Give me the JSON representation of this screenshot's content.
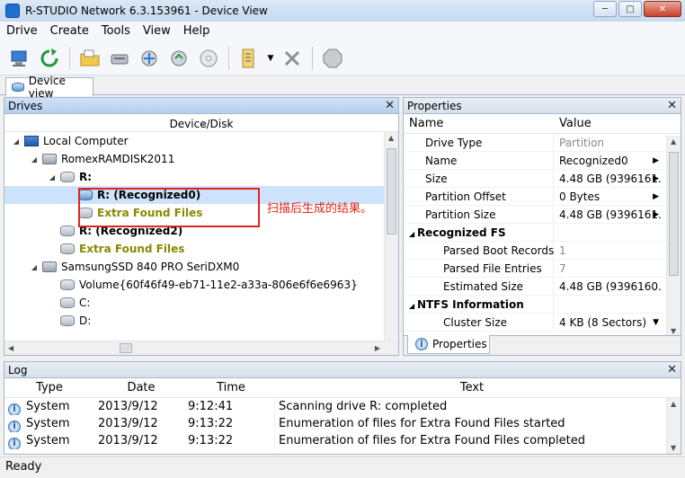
{
  "window": {
    "title": "R-STUDIO Network 6.3.153961 - Device View"
  },
  "menu": [
    "Drive",
    "Create",
    "Tools",
    "View",
    "Help"
  ],
  "doc_tab": {
    "label": "Device view"
  },
  "drives_panel": {
    "title": "Drives",
    "column": "Device/Disk",
    "rows": [
      {
        "label": "Local Computer",
        "level": 0,
        "icon": "computer-icon",
        "style": "normal"
      },
      {
        "label": "RomexRAMDISK2011",
        "level": 1,
        "icon": "disk-icon",
        "style": "normal"
      },
      {
        "label": "R:",
        "level": 2,
        "icon": "volume-icon",
        "style": "bold"
      },
      {
        "label": "R: (Recognized0)",
        "level": 3,
        "icon": "volume-icon",
        "style": "bold",
        "selected": true
      },
      {
        "label": "Extra Found Files",
        "level": 3,
        "icon": "volume-icon",
        "style": "olive"
      },
      {
        "label": "R: (Recognized2)",
        "level": 2,
        "icon": "volume-icon",
        "style": "bold"
      },
      {
        "label": "Extra Found Files",
        "level": 2,
        "icon": "volume-icon",
        "style": "olive"
      },
      {
        "label": "SamsungSSD 840 PRO SeriDXM0",
        "level": 1,
        "icon": "disk-icon",
        "style": "normal"
      },
      {
        "label": "Volume{60f46f49-eb71-11e2-a33a-806e6f6e6963}",
        "level": 2,
        "icon": "volume-icon",
        "style": "normal"
      },
      {
        "label": "C:",
        "level": 2,
        "icon": "volume-icon",
        "style": "normal"
      },
      {
        "label": "D:",
        "level": 2,
        "icon": "volume-icon",
        "style": "normal"
      }
    ],
    "annotation": "扫描后生成的结果。"
  },
  "properties_panel": {
    "title": "Properties",
    "columns": [
      "Name",
      "Value"
    ],
    "rows": [
      {
        "name": "Drive Type",
        "value": "Partition",
        "level": 1,
        "dim": true
      },
      {
        "name": "Name",
        "value": "Recognized0",
        "level": 1,
        "arrow": true
      },
      {
        "name": "Size",
        "value": "4.48 GB (9396161...",
        "level": 1,
        "arrow": true
      },
      {
        "name": "Partition Offset",
        "value": "0 Bytes",
        "level": 1,
        "arrow": true
      },
      {
        "name": "Partition Size",
        "value": "4.48 GB (9396161...",
        "level": 1,
        "arrow": true
      },
      {
        "name": "Recognized FS",
        "value": "",
        "level": 0,
        "group": true
      },
      {
        "name": "Parsed Boot Records",
        "value": "1",
        "level": 2,
        "dim": true
      },
      {
        "name": "Parsed File Entries",
        "value": "7",
        "level": 2,
        "dim": true
      },
      {
        "name": "Estimated Size",
        "value": "4.48 GB (9396160...",
        "level": 2
      },
      {
        "name": "NTFS Information",
        "value": "",
        "level": 0,
        "group": true
      },
      {
        "name": "Cluster Size",
        "value": "4 KB (8 Sectors)",
        "level": 2,
        "dropdown": true
      }
    ],
    "tab_label": "Properties"
  },
  "log_panel": {
    "title": "Log",
    "columns": [
      "Type",
      "Date",
      "Time",
      "Text"
    ],
    "rows": [
      {
        "type": "System",
        "date": "2013/9/12",
        "time": "9:12:41",
        "text": "Scanning drive R: completed"
      },
      {
        "type": "System",
        "date": "2013/9/12",
        "time": "9:13:22",
        "text": "Enumeration of files for Extra Found Files started"
      },
      {
        "type": "System",
        "date": "2013/9/12",
        "time": "9:13:22",
        "text": "Enumeration of files for Extra Found Files completed"
      }
    ]
  },
  "status": {
    "text": "Ready"
  }
}
